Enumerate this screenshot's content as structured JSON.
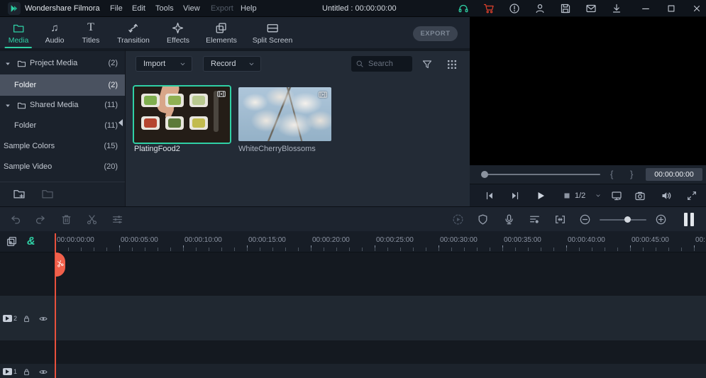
{
  "menubar": {
    "app_name": "Wondershare Filmora",
    "menus": [
      "File",
      "Edit",
      "Tools",
      "View",
      "Export",
      "Help"
    ],
    "document_title": "Untitled : 00:00:00:00"
  },
  "tabs": [
    {
      "label": "Media"
    },
    {
      "label": "Audio"
    },
    {
      "label": "Titles"
    },
    {
      "label": "Transition"
    },
    {
      "label": "Effects"
    },
    {
      "label": "Elements"
    },
    {
      "label": "Split Screen"
    }
  ],
  "export_button": "EXPORT",
  "sidebar": {
    "items": [
      {
        "label": "Project Media",
        "count": "(2)"
      },
      {
        "label": "Folder",
        "count": "(2)"
      },
      {
        "label": "Shared Media",
        "count": "(11)"
      },
      {
        "label": "Folder",
        "count": "(11)"
      },
      {
        "label": "Sample Colors",
        "count": "(15)"
      },
      {
        "label": "Sample Video",
        "count": "(20)"
      }
    ]
  },
  "media_toolbar": {
    "import_label": "Import",
    "record_label": "Record",
    "search_placeholder": "Search"
  },
  "media_items": [
    {
      "name": "PlatingFood2"
    },
    {
      "name": "WhiteCherryBlossoms"
    }
  ],
  "preview": {
    "timecode": "00:00:00:00",
    "quality": "1/2",
    "mark_in": "{",
    "mark_out": "}"
  },
  "timeline": {
    "ruler_labels": [
      "00:00:00:00",
      "00:00:05:00",
      "00:00:10:00",
      "00:00:15:00",
      "00:00:20:00",
      "00:00:25:00",
      "00:00:30:00",
      "00:00:35:00",
      "00:00:40:00",
      "00:00:45:00",
      "00:"
    ],
    "tracks": [
      {
        "number": "2"
      },
      {
        "number": "1"
      }
    ]
  },
  "icons": {
    "audio_glyph": "♫",
    "titles_glyph": "T",
    "auto_ripple_glyph": "&"
  },
  "colors": {
    "accent_teal": "#2fd0a5",
    "cart_red": "#e0412c",
    "playhead_red": "#f1604b",
    "selected_row": "#4a5260"
  }
}
